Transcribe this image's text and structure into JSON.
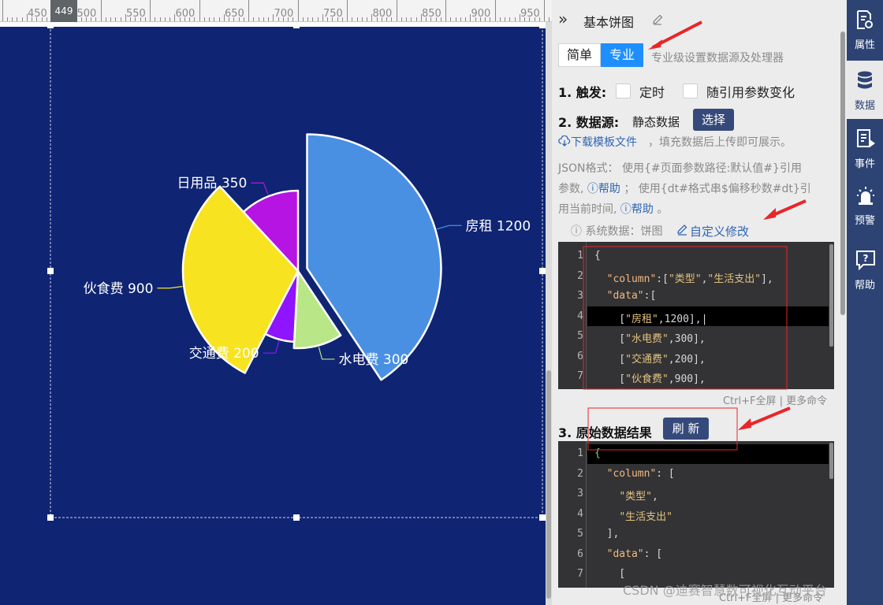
{
  "ruler": {
    "labels": [
      "450",
      "500",
      "550",
      "600",
      "650",
      "700",
      "750",
      "800",
      "850",
      "900",
      "950"
    ],
    "marker": "449"
  },
  "chart_data": {
    "type": "pie",
    "slices": [
      {
        "name": "房租",
        "value": 1200,
        "label": "房租 1200",
        "color": "#4a90e2"
      },
      {
        "name": "水电费",
        "value": 300,
        "label": "水电费 300",
        "color": "#b9e687"
      },
      {
        "name": "交通费",
        "value": 200,
        "label": "交通费 200",
        "color": "#8f14ff"
      },
      {
        "name": "伙食费",
        "value": 900,
        "label": "伙食费 900",
        "color": "#f7e31f"
      },
      {
        "name": "日用品",
        "value": 350,
        "label": "日用品 350",
        "color": "#b514e3"
      }
    ],
    "background": "#0f2473"
  },
  "panel": {
    "collapse_icon": "»",
    "title": "基本饼图",
    "mode_simple": "简单",
    "mode_pro": "专业",
    "mode_desc": "专业级设置数据源及处理器",
    "trigger_label": "1. 触发:",
    "trigger_timer": "定时",
    "trigger_param": "随引用参数变化",
    "source_label": "2. 数据源:",
    "source_value": "静态数据",
    "source_button": "选择",
    "download_link": "下载模板文件",
    "download_tail": "，填充数据后上传即可展示。",
    "json_line1": "JSON格式：  使用{#页面参数路径:默认值#}引用",
    "json_line2a": "参数,",
    "help1": "帮助",
    "json_line2b": "；  使用{dt#格式串$偏移秒数#dt}引",
    "json_line3a": "用当前时间,",
    "help2": "帮助",
    "json_line3b": "。",
    "system_data": "系统数据：饼图",
    "custom_edit": "自定义修改",
    "editor_footer": "Ctrl+F全屏 | 更多命令",
    "result_label": "3. 原始数据结果",
    "refresh_button": "刷 新",
    "editor_footer2": "Ctrl+F全屏 | 更多命令"
  },
  "tabs": [
    {
      "label": "属性",
      "icon": "properties-icon"
    },
    {
      "label": "数据",
      "icon": "database-icon"
    },
    {
      "label": "事件",
      "icon": "event-icon"
    },
    {
      "label": "预警",
      "icon": "alarm-icon"
    },
    {
      "label": "帮助",
      "icon": "help-icon"
    }
  ],
  "watermark": "CSDN @迪赛智慧数可视化互动平台",
  "colors": {
    "tab_bar": "#2d4374",
    "accent": "#1e8fff",
    "annotation": "#e8262a"
  }
}
